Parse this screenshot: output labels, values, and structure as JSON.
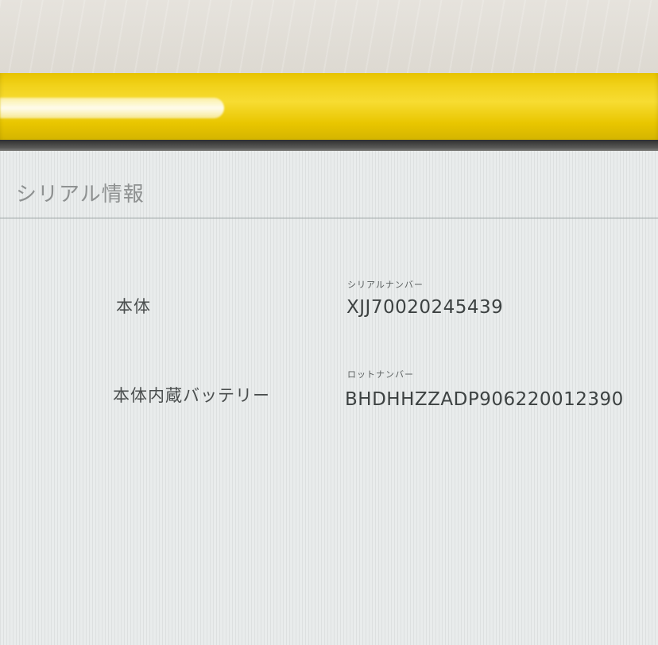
{
  "page": {
    "title": "シリアル情報"
  },
  "rows": [
    {
      "label": "本体",
      "field_caption": "シリアルナンバー",
      "value": "XJJ70020245439"
    },
    {
      "label": "本体内蔵バッテリー",
      "field_caption": "ロットナンバー",
      "value": "BHDHHZZADP906220012390"
    }
  ],
  "colors": {
    "device_frame": "#f1d21b",
    "screen_background": "#e9ecec",
    "title_text": "#8e9191",
    "value_text": "#3d4242"
  }
}
